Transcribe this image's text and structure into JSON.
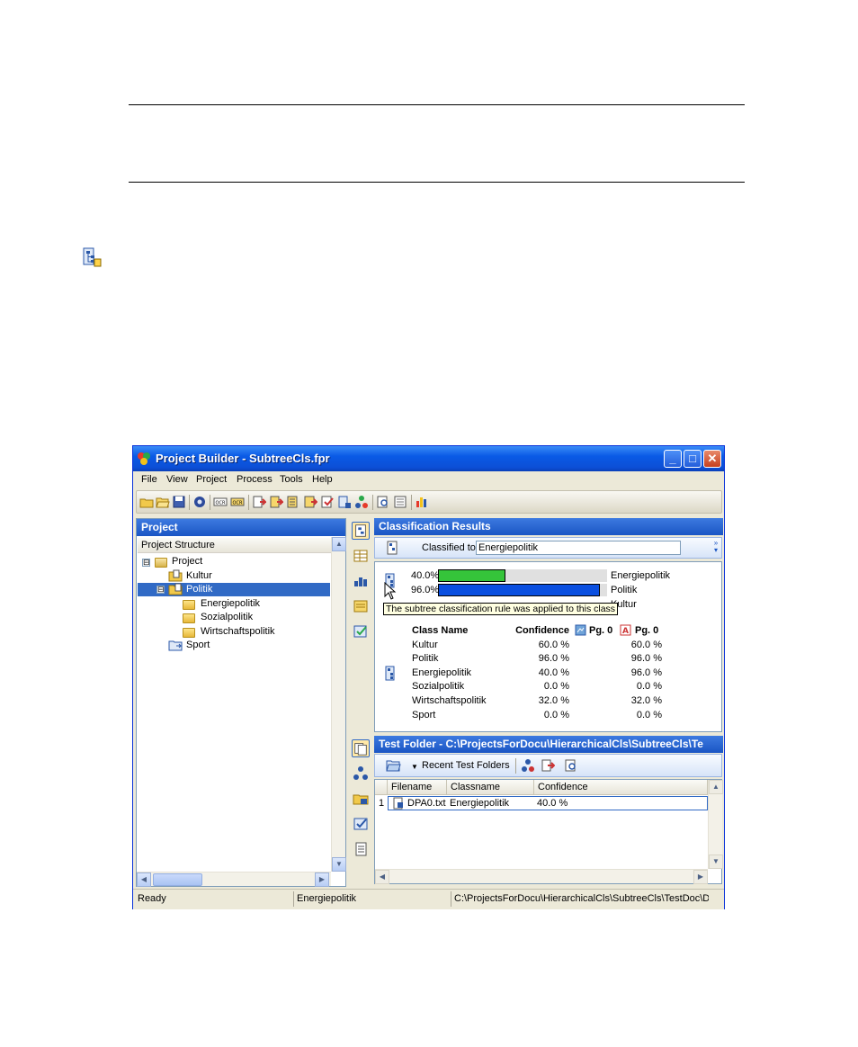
{
  "window": {
    "title": "Project Builder - SubtreeCls.fpr",
    "minimize": "_",
    "maximize": "□",
    "close": "✕"
  },
  "menu": [
    "File",
    "View",
    "Project",
    "Process",
    "Tools",
    "Help"
  ],
  "toolbar_icons": [
    "folder-new-icon",
    "folder-open-icon",
    "save-icon",
    "gear-icon",
    "ocr-icon",
    "ocr-batch-icon",
    "import-icon",
    "export-icon",
    "train-icon",
    "run-icon",
    "check-icon",
    "class-icon",
    "network-icon",
    "inspect-icon",
    "log-icon",
    "chart-icon"
  ],
  "project_panel": {
    "title": "Project",
    "tree_header": "Project Structure",
    "tree": [
      {
        "label": "Project",
        "level": 0,
        "expander": "⊟"
      },
      {
        "label": "Kultur",
        "level": 1
      },
      {
        "label": "Politik",
        "level": 1,
        "expander": "⊟",
        "selected": true
      },
      {
        "label": "Energiepolitik",
        "level": 2
      },
      {
        "label": "Sozialpolitik",
        "level": 2
      },
      {
        "label": "Wirtschaftspolitik",
        "level": 2
      },
      {
        "label": "Sport",
        "level": 1
      }
    ]
  },
  "classification": {
    "title": "Classification Results",
    "classified_to_label": "Classified to",
    "classified_to_value": "Energiepolitik",
    "bars": [
      {
        "value_label": "40.0%",
        "fraction": 0.4,
        "color": "#35c43a",
        "name": "Energiepolitik"
      },
      {
        "value_label": "96.0%",
        "fraction": 0.96,
        "color": "#0a4fe0",
        "name": "Politik"
      }
    ],
    "third_bar_name_partial": "Kultur",
    "tooltip": "The subtree classification rule was applied to this class",
    "table_headers": {
      "name": "Class Name",
      "confidence": "Confidence",
      "pg_text": "Pg. 0",
      "pg_pdf": "Pg. 0"
    },
    "rows": [
      {
        "name": "Kultur",
        "confidence": "60.0 %",
        "pg": "60.0 %"
      },
      {
        "name": "Politik",
        "confidence": "96.0 %",
        "pg": "96.0 %"
      },
      {
        "name": "Energiepolitik",
        "confidence": "40.0 %",
        "pg": "96.0 %",
        "rule_icon": true
      },
      {
        "name": "Sozialpolitik",
        "confidence": "0.0 %",
        "pg": "0.0 %"
      },
      {
        "name": "Wirtschaftspolitik",
        "confidence": "32.0 %",
        "pg": "32.0 %"
      },
      {
        "name": "Sport",
        "confidence": "0.0 %",
        "pg": "0.0 %"
      }
    ]
  },
  "test_folder": {
    "title": "Test Folder - C:\\ProjectsForDocu\\HierarchicalCls\\SubtreeCls\\Te",
    "recent_label": "Recent Test Folders",
    "columns": [
      "Filename",
      "Classname",
      "Confidence"
    ],
    "rows": [
      {
        "index": "1",
        "filename": "DPA0.txt",
        "classname": "Energiepolitik",
        "confidence": "40.0 %"
      }
    ]
  },
  "status": {
    "state": "Ready",
    "class": "Energiepolitik",
    "path": "C:\\ProjectsForDocu\\HierarchicalCls\\SubtreeCls\\TestDoc\\DPA"
  },
  "colors": {
    "accent": "#0a5ae6",
    "selection": "#316ac5",
    "tooltip": "#ffffe1"
  }
}
